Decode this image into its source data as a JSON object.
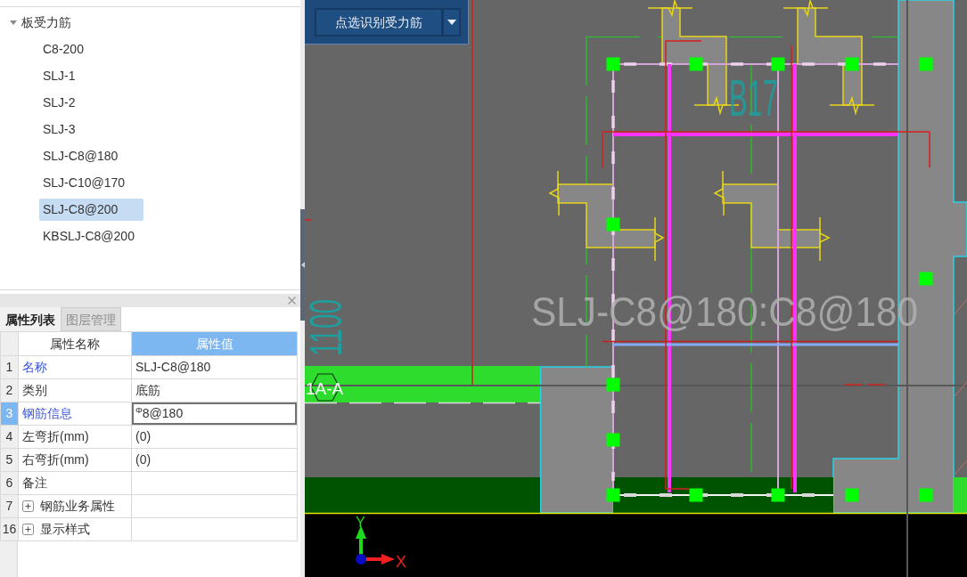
{
  "tree": {
    "label": "板受力筋",
    "expanded": true,
    "children": [
      {
        "label": "C8-200",
        "selected": false
      },
      {
        "label": "SLJ-1",
        "selected": false
      },
      {
        "label": "SLJ-2",
        "selected": false
      },
      {
        "label": "SLJ-3",
        "selected": false
      },
      {
        "label": "SLJ-C8@180",
        "selected": false
      },
      {
        "label": "SLJ-C10@170",
        "selected": false
      },
      {
        "label": "SLJ-C8@200",
        "selected": true
      },
      {
        "label": "KBSLJ-C8@200",
        "selected": false
      }
    ]
  },
  "properties": {
    "tabs": [
      {
        "label": "属性列表",
        "selected": true
      },
      {
        "label": "图层管理",
        "selected": false
      }
    ],
    "columns": [
      {
        "label": "属性名称",
        "selected": false
      },
      {
        "label": "属性值",
        "selected": true
      }
    ],
    "rows": [
      {
        "index": "1",
        "kind": "field",
        "name": "名称",
        "value": "SLJ-C8@180",
        "public": true,
        "selected": false
      },
      {
        "index": "2",
        "kind": "field",
        "name": "类别",
        "value": "底筋",
        "public": false,
        "selected": false
      },
      {
        "index": "3",
        "kind": "field",
        "name": "钢筋信息",
        "value": "$^{Φ}$8@180",
        "public": true,
        "selected": true
      },
      {
        "index": "4",
        "kind": "field",
        "name": "左弯折(mm)",
        "value": "(0)",
        "public": false,
        "selected": false
      },
      {
        "index": "5",
        "kind": "field",
        "name": "右弯折(mm)",
        "value": "(0)",
        "public": false,
        "selected": false
      },
      {
        "index": "6",
        "kind": "field",
        "name": "备注",
        "public": false,
        "selected": false
      },
      {
        "index": "7",
        "kind": "group",
        "name": "钢筋业务属性",
        "expanded": false,
        "public": false,
        "selected": false
      },
      {
        "index": "16",
        "kind": "group",
        "name": "显示样式",
        "expanded": false,
        "public": false,
        "selected": false
      }
    ]
  },
  "canvas": {
    "tool_button": "点选识别受力筋",
    "slab_label": "B17",
    "rebar_label": "SLJ-C8@180:C8@180",
    "dimension": "1100",
    "grid_label": "1A-A",
    "axis_x": "X",
    "axis_y": "Y"
  }
}
